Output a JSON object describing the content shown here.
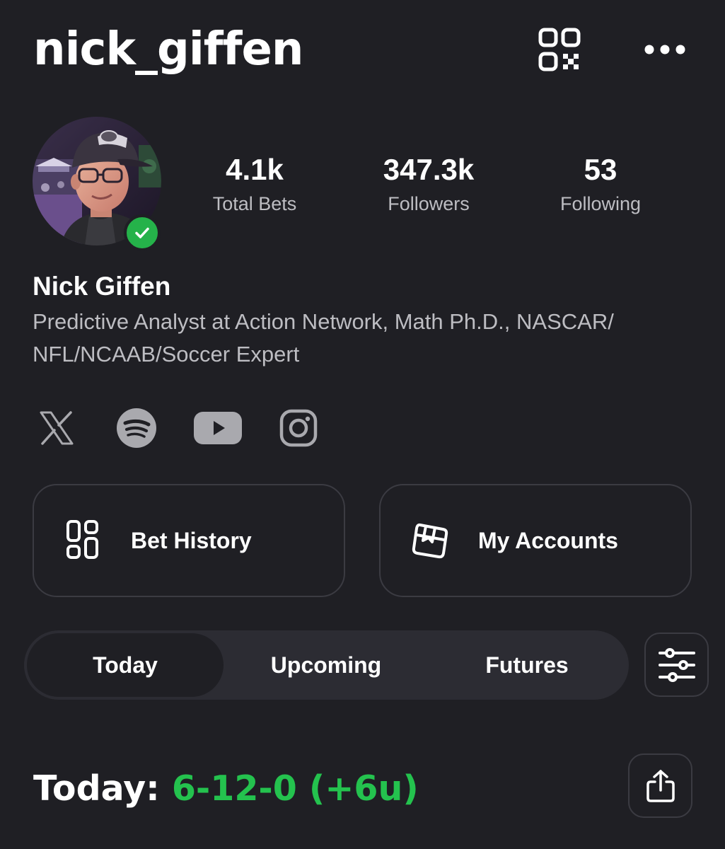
{
  "profile": {
    "username": "nick_giffen",
    "display_name": "Nick Giffen",
    "bio": "Predictive Analyst at Action Network, Math Ph.D., NASCAR/ NFL/NCAAB/Soccer Expert",
    "verified": true
  },
  "header": {
    "qr_icon": "qr-code-icon",
    "more_icon": "more-horizontal-icon"
  },
  "stats": [
    {
      "value": "4.1k",
      "label": "Total Bets"
    },
    {
      "value": "347.3k",
      "label": "Followers"
    },
    {
      "value": "53",
      "label": "Following"
    }
  ],
  "social": [
    {
      "name": "x-icon"
    },
    {
      "name": "spotify-icon"
    },
    {
      "name": "youtube-icon"
    },
    {
      "name": "instagram-icon"
    }
  ],
  "cards": {
    "bet_history": "Bet History",
    "my_accounts": "My Accounts"
  },
  "tabs": [
    {
      "label": "Today",
      "active": true
    },
    {
      "label": "Upcoming",
      "active": false
    },
    {
      "label": "Futures",
      "active": false
    }
  ],
  "summary": {
    "label": "Today:",
    "record": "6-12-0 (+6u)"
  },
  "colors": {
    "background": "#1f1f24",
    "accent_green": "#24c24e",
    "muted_text": "#bdbdc2",
    "border": "#3b3b42"
  }
}
